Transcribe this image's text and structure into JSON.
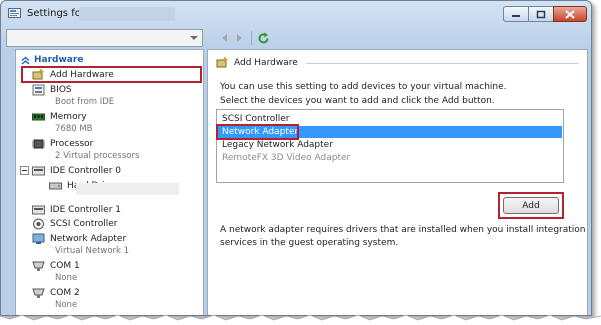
{
  "window": {
    "title": "Settings for"
  },
  "toolbar": {
    "vm_selector_value": "",
    "back_icon": "triangle-left-icon",
    "forward_icon": "triangle-right-icon",
    "refresh_icon": "refresh-icon"
  },
  "sidebar": {
    "section_title": "Hardware",
    "items": [
      {
        "label": "Add Hardware",
        "sub": "",
        "icon": "add-hardware-icon"
      },
      {
        "label": "BIOS",
        "sub": "Boot from IDE",
        "icon": "bios-icon"
      },
      {
        "label": "Memory",
        "sub": "7680 MB",
        "icon": "memory-icon"
      },
      {
        "label": "Processor",
        "sub": "2 Virtual processors",
        "icon": "processor-icon"
      },
      {
        "label": "IDE Controller 0",
        "sub": "",
        "icon": "ide-controller-icon"
      },
      {
        "label": "Hard Drive",
        "sub": "",
        "icon": "hard-drive-icon"
      },
      {
        "label": "IDE Controller 1",
        "sub": "",
        "icon": "ide-controller-icon"
      },
      {
        "label": "SCSI Controller",
        "sub": "",
        "icon": "scsi-controller-icon"
      },
      {
        "label": "Network Adapter",
        "sub": "Virtual Network 1",
        "icon": "network-adapter-icon"
      },
      {
        "label": "COM 1",
        "sub": "None",
        "icon": "com-port-icon"
      },
      {
        "label": "COM 2",
        "sub": "None",
        "icon": "com-port-icon"
      }
    ]
  },
  "main": {
    "header": "Add Hardware",
    "intro": "You can use this setting to add devices to your virtual machine.",
    "instruction": "Select the devices you want to add and click the Add button.",
    "devices": [
      {
        "label": "SCSI Controller",
        "state": "normal"
      },
      {
        "label": "Network Adapter",
        "state": "selected"
      },
      {
        "label": "Legacy Network Adapter",
        "state": "normal"
      },
      {
        "label": "RemoteFX 3D Video Adapter",
        "state": "disabled"
      }
    ],
    "add_button": "Add",
    "note_line1": "A network adapter requires drivers that are installed when you install integration",
    "note_line2": "services in the guest operating system."
  },
  "colors": {
    "highlight": "#b3232f",
    "selection": "#3399ff",
    "section_title": "#1f5fb0"
  }
}
